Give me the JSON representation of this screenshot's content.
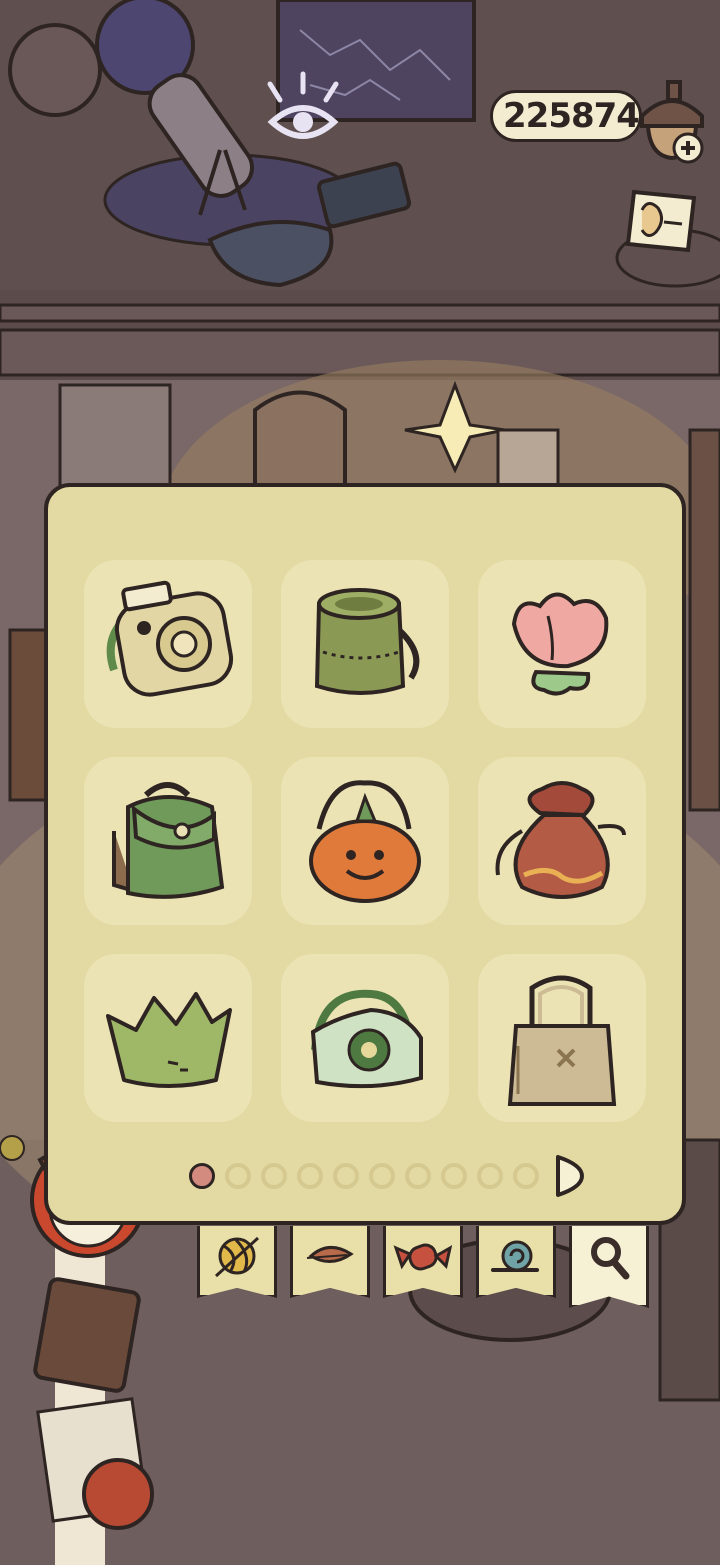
{
  "currency": {
    "amount": "225874"
  },
  "icons": {
    "eye": "eye-icon",
    "acorn_add": "acorn-plus-icon",
    "note": "note-icon",
    "next": "next-page-arrow-icon"
  },
  "items": [
    {
      "name": "instant-camera-bag",
      "color": "#e2d6a4"
    },
    {
      "name": "green-bucket-bag",
      "color": "#8a9a55"
    },
    {
      "name": "tulip-pouch",
      "color": "#f0a9a2"
    },
    {
      "name": "green-backpack",
      "color": "#6f9a5a"
    },
    {
      "name": "pumpkin-bucket",
      "color": "#e07a3a"
    },
    {
      "name": "drawstring-pouch",
      "color": "#b35b45"
    },
    {
      "name": "leaf-crown-basket",
      "color": "#9fb868"
    },
    {
      "name": "crochet-tote",
      "color": "#cfe2c4"
    },
    {
      "name": "woven-tote",
      "color": "#cdbb95"
    }
  ],
  "pager": {
    "pages": 10,
    "current": 1
  },
  "tabs": [
    {
      "name": "yarn-ball-tab",
      "selected": false
    },
    {
      "name": "leaf-tab",
      "selected": false
    },
    {
      "name": "candy-tab",
      "selected": false
    },
    {
      "name": "snail-tab",
      "selected": false
    },
    {
      "name": "magnifier-tab",
      "selected": true
    }
  ]
}
